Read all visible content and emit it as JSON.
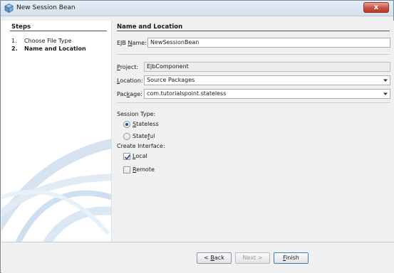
{
  "window": {
    "title": "New Session Bean",
    "close_label": "x"
  },
  "steps": {
    "title": "Steps",
    "items": [
      {
        "num": "1.",
        "label": "Choose File Type"
      },
      {
        "num": "2.",
        "label": "Name and Location"
      }
    ]
  },
  "main": {
    "section_title": "Name and Location",
    "ejb_name": {
      "label_pre": "EJB ",
      "label_key": "N",
      "label_post": "ame:",
      "value": "NewSessionBean"
    },
    "project": {
      "label_pre": "",
      "label_key": "P",
      "label_post": "roject:",
      "value": "EjbComponent"
    },
    "location": {
      "label_pre": "",
      "label_key": "L",
      "label_post": "ocation:",
      "value": "Source Packages"
    },
    "package": {
      "label_pre": "Pac",
      "label_key": "k",
      "label_post": "age:",
      "value": "com.tutorialspoint.stateless"
    },
    "session_type": {
      "label": "Session Type:",
      "options": [
        {
          "pre": "",
          "key": "S",
          "post": "tateless",
          "selected": true
        },
        {
          "pre": "State",
          "key": "f",
          "post": "ul",
          "selected": false
        }
      ]
    },
    "create_interface": {
      "label": "Create Interface:",
      "options": [
        {
          "pre": "",
          "key": "L",
          "post": "ocal",
          "checked": true
        },
        {
          "pre": "",
          "key": "R",
          "post": "emote",
          "checked": false
        }
      ]
    }
  },
  "buttons": {
    "back": {
      "pre": "< ",
      "key": "B",
      "post": "ack"
    },
    "next": "Next >",
    "finish": {
      "pre": "",
      "key": "F",
      "post": "inish"
    }
  }
}
